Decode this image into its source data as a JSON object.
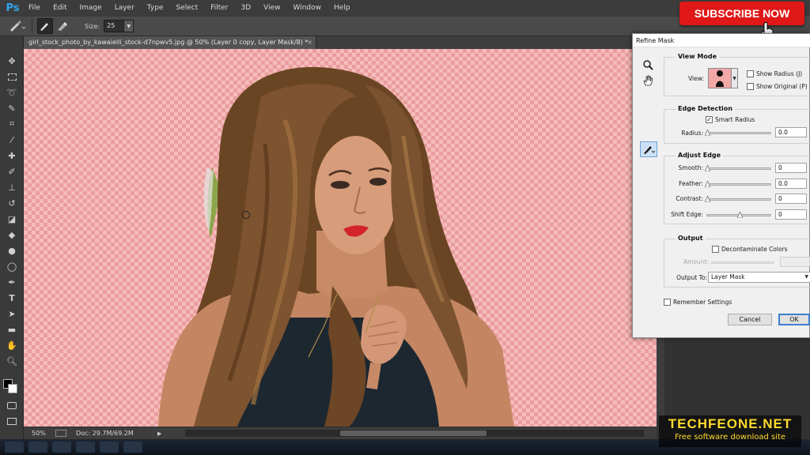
{
  "app": {
    "logo": "Ps"
  },
  "menu": [
    "File",
    "Edit",
    "Image",
    "Layer",
    "Type",
    "Select",
    "Filter",
    "3D",
    "View",
    "Window",
    "Help"
  ],
  "options": {
    "size_label": "Size:",
    "size_value": "25"
  },
  "overlay": {
    "subscribe": "SUBSCRIBE NOW"
  },
  "document": {
    "tab_title": "girl_stock_photo_by_kawaielli_stock-d7npwv5.jpg @ 50% (Layer 0 copy, Layer Mask/8) *",
    "tab_close": "×"
  },
  "status": {
    "zoom": "50%",
    "doc_size": "Doc: 29.7M/69.2M"
  },
  "dialog": {
    "title": "Refine Mask",
    "view_mode": {
      "title": "View Mode",
      "view_label": "View:",
      "show_radius": "Show Radius (J)",
      "show_radius_checked": false,
      "show_original": "Show Original (P)",
      "show_original_checked": false
    },
    "edge_detection": {
      "title": "Edge Detection",
      "smart_radius": "Smart Radius",
      "smart_radius_checked": true,
      "radius_label": "Radius:",
      "radius_value": "0.0"
    },
    "adjust_edge": {
      "title": "Adjust Edge",
      "smooth_label": "Smooth:",
      "smooth_value": "0",
      "feather_label": "Feather:",
      "feather_value": "0.0",
      "contrast_label": "Contrast:",
      "contrast_value": "0",
      "shift_label": "Shift Edge:",
      "shift_value": "0"
    },
    "output": {
      "title": "Output",
      "decontaminate": "Decontaminate Colors",
      "decontaminate_checked": false,
      "amount_label": "Amount:",
      "output_to_label": "Output To:",
      "output_to_value": "Layer Mask"
    },
    "remember": "Remember Settings",
    "remember_checked": false,
    "cancel": "Cancel",
    "ok": "OK"
  },
  "watermark": {
    "title": "TECHFEONE.NET",
    "subtitle": "Free software download site"
  },
  "colors": {
    "accent_ps": "#2fa3f0",
    "subscribe_red": "#e01818",
    "checker_pink": "#f6bcbc",
    "watermark_yellow": "#ffd92c"
  }
}
